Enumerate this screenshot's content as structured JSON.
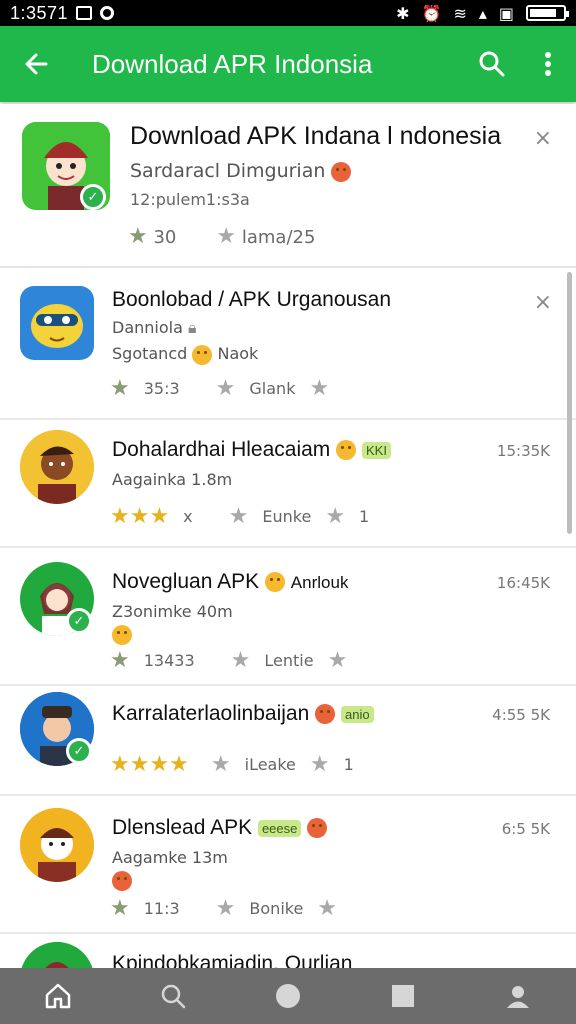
{
  "status_bar": {
    "time": "1:3571",
    "icons": [
      "image-icon",
      "notification-icon",
      "bluetooth-icon",
      "alarm-icon",
      "wifi-icon",
      "signal-icon",
      "sim-icon",
      "battery-icon"
    ]
  },
  "app_bar": {
    "title": "Download APR Indonsia",
    "back_icon": "back-arrow-icon",
    "search_icon": "search-icon",
    "more_icon": "more-vert-icon"
  },
  "featured": {
    "title": "Download APK Indana l ndonesia",
    "subtitle": "Sardaracl Dimgurian",
    "meta": "12:pulem1:s3a",
    "rating_left": "30",
    "rating_right": "lama/25",
    "close": "×"
  },
  "items": [
    {
      "title": "Boonlobad / APK Urganousan",
      "line2": "Danniola",
      "line3": "Sgotancd",
      "line3b": "Naok",
      "rating_left": "35:3",
      "rating_right": "Glank",
      "size": "",
      "close": "×"
    },
    {
      "title": "Dohalardhai Hleacaiam",
      "tag": "KKI",
      "line2": "Aagainka 1.8m",
      "rating_left": "x",
      "rating_right": "Eunke",
      "rating_right_suffix": "1",
      "size": "15:35K"
    },
    {
      "title": "Novegluan APK",
      "title_suffix": "Anrlouk",
      "line2": "Z3onimke 40m",
      "rating_left": "13433",
      "rating_right": "Lentie",
      "size": "16:45K"
    },
    {
      "title": "Karralaterlaolinbaijan",
      "tag": "anio",
      "rating_right": "iLeake",
      "rating_right_suffix": "1",
      "size": "4:55 5K"
    },
    {
      "title": "Dlenslead APK",
      "tag": "eeese",
      "line2": "Aagamke 13m",
      "rating_left": "11:3",
      "rating_right": "Bonike",
      "size": "6:5 5K"
    },
    {
      "title": "Kpindobkamiadin. Ourlian"
    }
  ],
  "nav_bar": {
    "items": [
      "home-icon",
      "search-icon",
      "circle-icon",
      "square-icon",
      "profile-icon"
    ]
  },
  "colors": {
    "app_bar": "#20b84a",
    "check_badge": "#2bb24c",
    "nav_bar": "#6c6c6c"
  }
}
